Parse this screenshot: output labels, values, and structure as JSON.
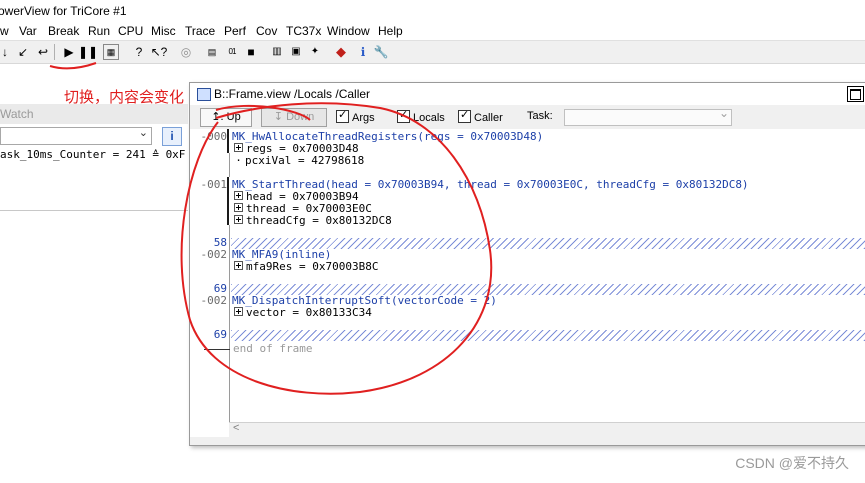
{
  "window": {
    "title": "owerView for TriCore #1"
  },
  "menu": [
    "w",
    "Var",
    "Break",
    "Run",
    "CPU",
    "Misc",
    "Trace",
    "Perf",
    "Cov",
    "TC37x",
    "Window",
    "Help"
  ],
  "annotation": {
    "text": "切换，内容会变化"
  },
  "watch": {
    "title": "Watch",
    "row": "ask_10ms_Counter = 241 ≙ 0xF"
  },
  "frame": {
    "title": "B::Frame.view /Locals /Caller",
    "buttons": {
      "up": "Up",
      "down": "Down"
    },
    "checkboxes": {
      "args": "Args",
      "locals": "Locals",
      "caller": "Caller"
    },
    "task_label": "Task:",
    "rows": [
      {
        "num": "-000",
        "text": "MK_HwAllocateThreadRegisters(regs = 0x70003D48)",
        "kind": "func"
      },
      {
        "num": "",
        "text": "regs = 0x70003D48",
        "kind": "var"
      },
      {
        "num": "",
        "text": "pcxiVal = 42798618",
        "kind": "dot"
      },
      {
        "num": "-001",
        "text": "MK_StartThread(head = 0x70003B94, thread = 0x70003E0C, threadCfg = 0x80132DC8)",
        "kind": "func"
      },
      {
        "num": "",
        "text": "head = 0x70003B94",
        "kind": "var"
      },
      {
        "num": "",
        "text": "thread = 0x70003E0C",
        "kind": "var"
      },
      {
        "num": "",
        "text": "threadCfg = 0x80132DC8",
        "kind": "var"
      },
      {
        "num": "58",
        "text": "",
        "kind": "hatch"
      },
      {
        "num": "-002",
        "text": "MK_MFA9(inline)",
        "kind": "func"
      },
      {
        "num": "",
        "text": "mfa9Res = 0x70003B8C",
        "kind": "var"
      },
      {
        "num": "69",
        "text": "",
        "kind": "hatch"
      },
      {
        "num": "-002",
        "text": "MK_DispatchInterruptSoft(vectorCode = 2)",
        "kind": "func"
      },
      {
        "num": "",
        "text": "vector = 0x80133C34",
        "kind": "var"
      },
      {
        "num": "69",
        "text": "",
        "kind": "hatch"
      },
      {
        "num": "",
        "text": "end of frame",
        "kind": "end"
      }
    ]
  },
  "watermark": "CSDN @爱不持久",
  "colors": {
    "annotation": "#e01e1e",
    "function": "#1c3fa8",
    "hatch": "#7c8ed8"
  }
}
